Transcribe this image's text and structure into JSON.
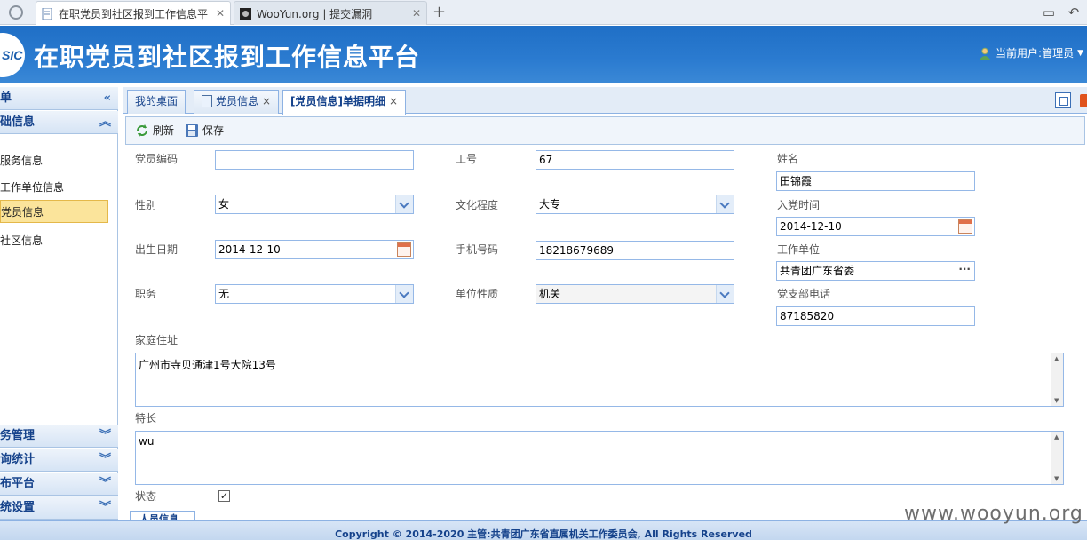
{
  "browser": {
    "tabs": [
      {
        "title": "在职党员到社区报到工作信息平"
      },
      {
        "title": "WooYun.org | 提交漏洞"
      }
    ],
    "new_tab": "+"
  },
  "header": {
    "logo_text": "SIC",
    "title": "在职党员到社区报到工作信息平台",
    "user_label": "当前用户:管理员"
  },
  "sidebar": {
    "menu_head": "菜单",
    "section_head": "基础信息",
    "items": [
      {
        "label": "服务信息"
      },
      {
        "label": "工作单位信息"
      },
      {
        "label": "党员信息"
      },
      {
        "label": "社区信息"
      }
    ],
    "bottom_groups": [
      {
        "label": "服务管理"
      },
      {
        "label": "查询统计"
      },
      {
        "label": "发布平台"
      },
      {
        "label": "系统设置"
      }
    ]
  },
  "content_tabs": [
    {
      "label": "我的桌面"
    },
    {
      "label": "党员信息"
    },
    {
      "label": "[党员信息]单据明细"
    }
  ],
  "toolbar": {
    "refresh_label": "刷新",
    "save_label": "保存"
  },
  "form": {
    "member_code": {
      "label": "党员编码",
      "value": ""
    },
    "job_no": {
      "label": "工号",
      "value": "67"
    },
    "name": {
      "label": "姓名",
      "value": "田锦霞"
    },
    "gender": {
      "label": "性别",
      "value": "女"
    },
    "education": {
      "label": "文化程度",
      "value": "大专"
    },
    "join_date": {
      "label": "入党时间",
      "value": "2014-12-10"
    },
    "birth_date": {
      "label": "出生日期",
      "value": "2014-12-10"
    },
    "mobile": {
      "label": "手机号码",
      "value": "18218679689"
    },
    "work_unit": {
      "label": "工作单位",
      "value": "共青团广东省委"
    },
    "position": {
      "label": "职务",
      "value": "无"
    },
    "unit_type": {
      "label": "单位性质",
      "value": "机关"
    },
    "branch_phone": {
      "label": "党支部电话",
      "value": "87185820"
    },
    "address": {
      "label": "家庭住址",
      "value": "广州市寺贝通津1号大院13号"
    },
    "specialty": {
      "label": "特长",
      "value": "wu"
    },
    "status": {
      "label": "状态",
      "checked": true
    }
  },
  "bottom_tab": {
    "label": "人员信息"
  },
  "footer": {
    "text": "Copyright © 2014-2020 主管:共青团广东省直属机关工作委员会, All Rights Reserved"
  },
  "watermark": "www.wooyun.org",
  "colors": {
    "header_blue": "#2b7bd0",
    "selected_item": "#fbe49b",
    "border_blue": "#95b8e7"
  }
}
